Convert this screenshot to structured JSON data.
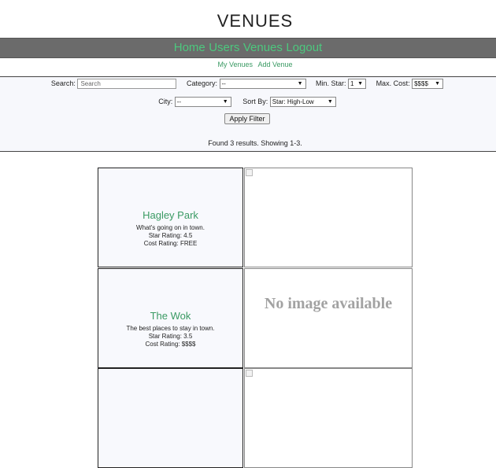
{
  "page": {
    "title": "VENUES"
  },
  "nav": {
    "items": [
      "Home",
      "Users",
      "Venues",
      "Logout"
    ]
  },
  "subnav": {
    "my_venues": "My Venues",
    "add_venue": "Add Venue"
  },
  "filters": {
    "search_label": "Search:",
    "search_placeholder": "Search",
    "category_label": "Category:",
    "category_value": "--",
    "min_star_label": "Min. Star:",
    "min_star_value": "1",
    "max_cost_label": "Max. Cost:",
    "max_cost_value": "$$$$",
    "city_label": "City:",
    "city_value": "--",
    "sort_label": "Sort By:",
    "sort_value": "Star: High-Low",
    "apply_label": "Apply Filter"
  },
  "results": {
    "summary": "Found 3 results. Showing 1-3."
  },
  "venues": [
    {
      "name": "Hagley Park",
      "tagline": "What's going on in town.",
      "star": "Star Rating: 4.5",
      "cost": "Cost Rating: FREE",
      "image_text": ""
    },
    {
      "name": "The Wok",
      "tagline": "The best places to stay in town.",
      "star": "Star Rating: 3.5",
      "cost": "Cost Rating: $$$$",
      "image_text": "No image available"
    }
  ],
  "colors": {
    "accent": "#3a9a63",
    "navbar": "#6b6b6b",
    "filter_bg": "#f7f8fc"
  }
}
